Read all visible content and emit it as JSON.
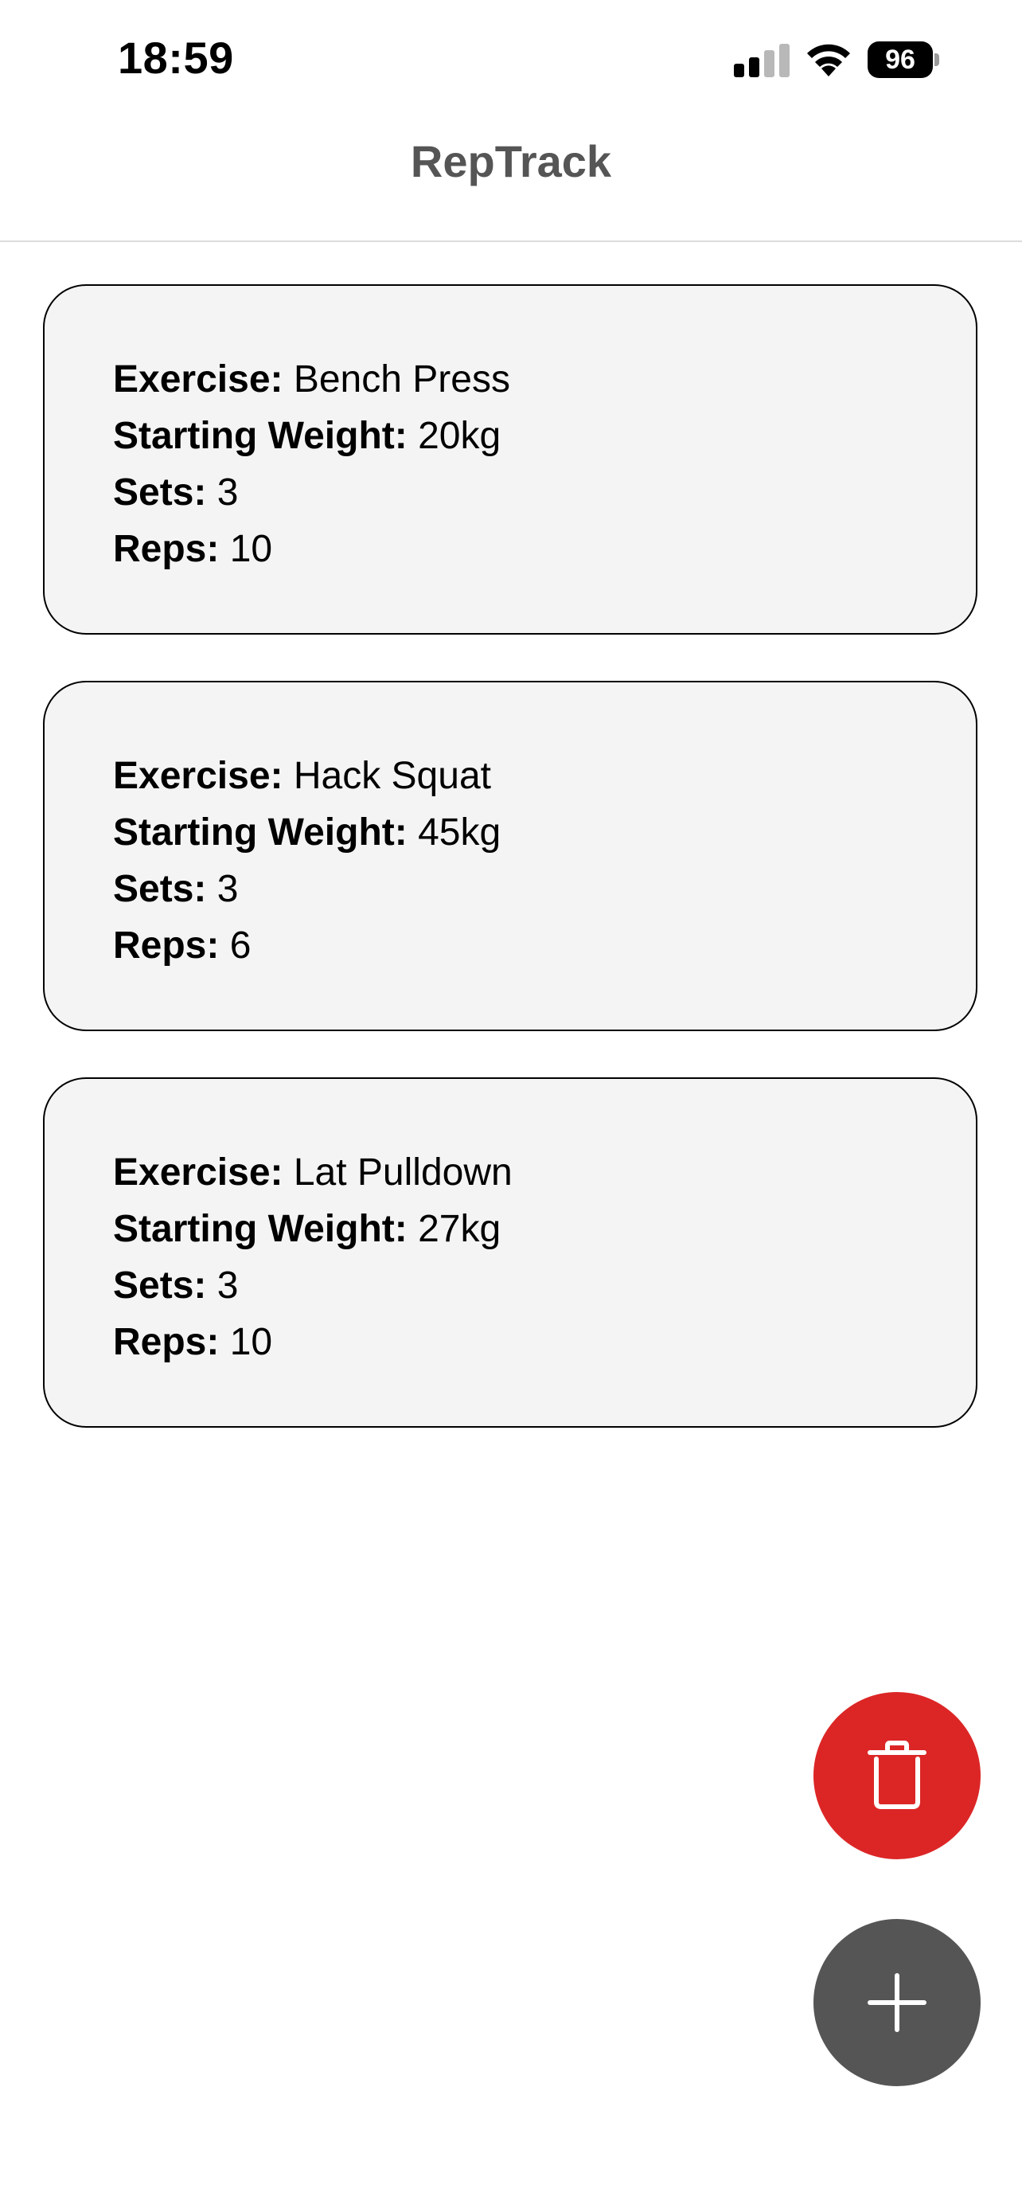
{
  "status_bar": {
    "time": "18:59",
    "battery": "96"
  },
  "header": {
    "title": "RepTrack"
  },
  "labels": {
    "exercise": "Exercise:",
    "starting_weight": "Starting Weight:",
    "sets": "Sets:",
    "reps": "Reps:"
  },
  "workouts": [
    {
      "exercise": "Bench Press",
      "starting_weight": "20kg",
      "sets": "3",
      "reps": "10"
    },
    {
      "exercise": "Hack Squat",
      "starting_weight": "45kg",
      "sets": "3",
      "reps": "6"
    },
    {
      "exercise": "Lat Pulldown",
      "starting_weight": "27kg",
      "sets": "3",
      "reps": "10"
    }
  ],
  "actions": {
    "delete_icon": "trash-icon",
    "add_icon": "plus-icon"
  },
  "colors": {
    "delete_button": "#dc2626",
    "add_button": "#555555",
    "card_background": "#f4f4f4",
    "title": "#555555"
  }
}
